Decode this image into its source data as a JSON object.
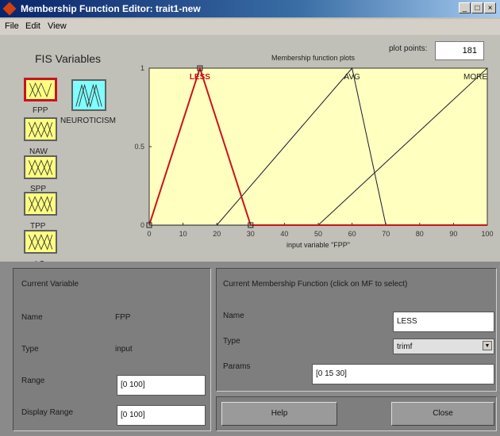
{
  "window": {
    "title": "Membership Function Editor: trait1-new",
    "controls": [
      "_",
      "□",
      "×"
    ]
  },
  "menu": [
    "File",
    "Edit",
    "View"
  ],
  "fis": {
    "heading": "FIS Variables",
    "inputs": [
      "FPP",
      "NAW",
      "SPP",
      "TPP",
      "LS"
    ],
    "output": "NEUROTICISM",
    "selected": "FPP"
  },
  "plot": {
    "title": "Membership function plots",
    "points_label": "plot points:",
    "points_value": "181"
  },
  "chart_data": {
    "type": "line",
    "xlabel": "input variable \"FPP\"",
    "xlim": [
      0,
      100
    ],
    "ylim": [
      0,
      1
    ],
    "x_ticks": [
      "0",
      "10",
      "20",
      "30",
      "40",
      "50",
      "60",
      "70",
      "80",
      "90",
      "100"
    ],
    "y_ticks": [
      "0",
      "0.5",
      "1"
    ],
    "series": [
      {
        "name": "LESS",
        "type": "trimf",
        "params": [
          0,
          15,
          30
        ],
        "color": "#c8141e",
        "selected": true
      },
      {
        "name": "AVG",
        "type": "trimf",
        "params": [
          20,
          60,
          70
        ],
        "color": "#1a1a2e",
        "selected": false
      },
      {
        "name": "MORE",
        "type": "trimf",
        "params": [
          50,
          100,
          150
        ],
        "color": "#1a1a2e",
        "selected": false
      }
    ],
    "background": "#ffffc0"
  },
  "current_variable": {
    "heading": "Current Variable",
    "name_label": "Name",
    "name_value": "FPP",
    "type_label": "Type",
    "type_value": "input",
    "range_label": "Range",
    "range_value": "[0 100]",
    "display_range_label": "Display Range",
    "display_range_value": "[0 100]"
  },
  "current_mf": {
    "heading": "Current Membership Function (click on MF to select)",
    "name_label": "Name",
    "name_value": "LESS",
    "type_label": "Type",
    "type_value": "trimf",
    "params_label": "Params",
    "params_value": "[0 15 30]"
  },
  "buttons": {
    "help": "Help",
    "close": "Close"
  }
}
